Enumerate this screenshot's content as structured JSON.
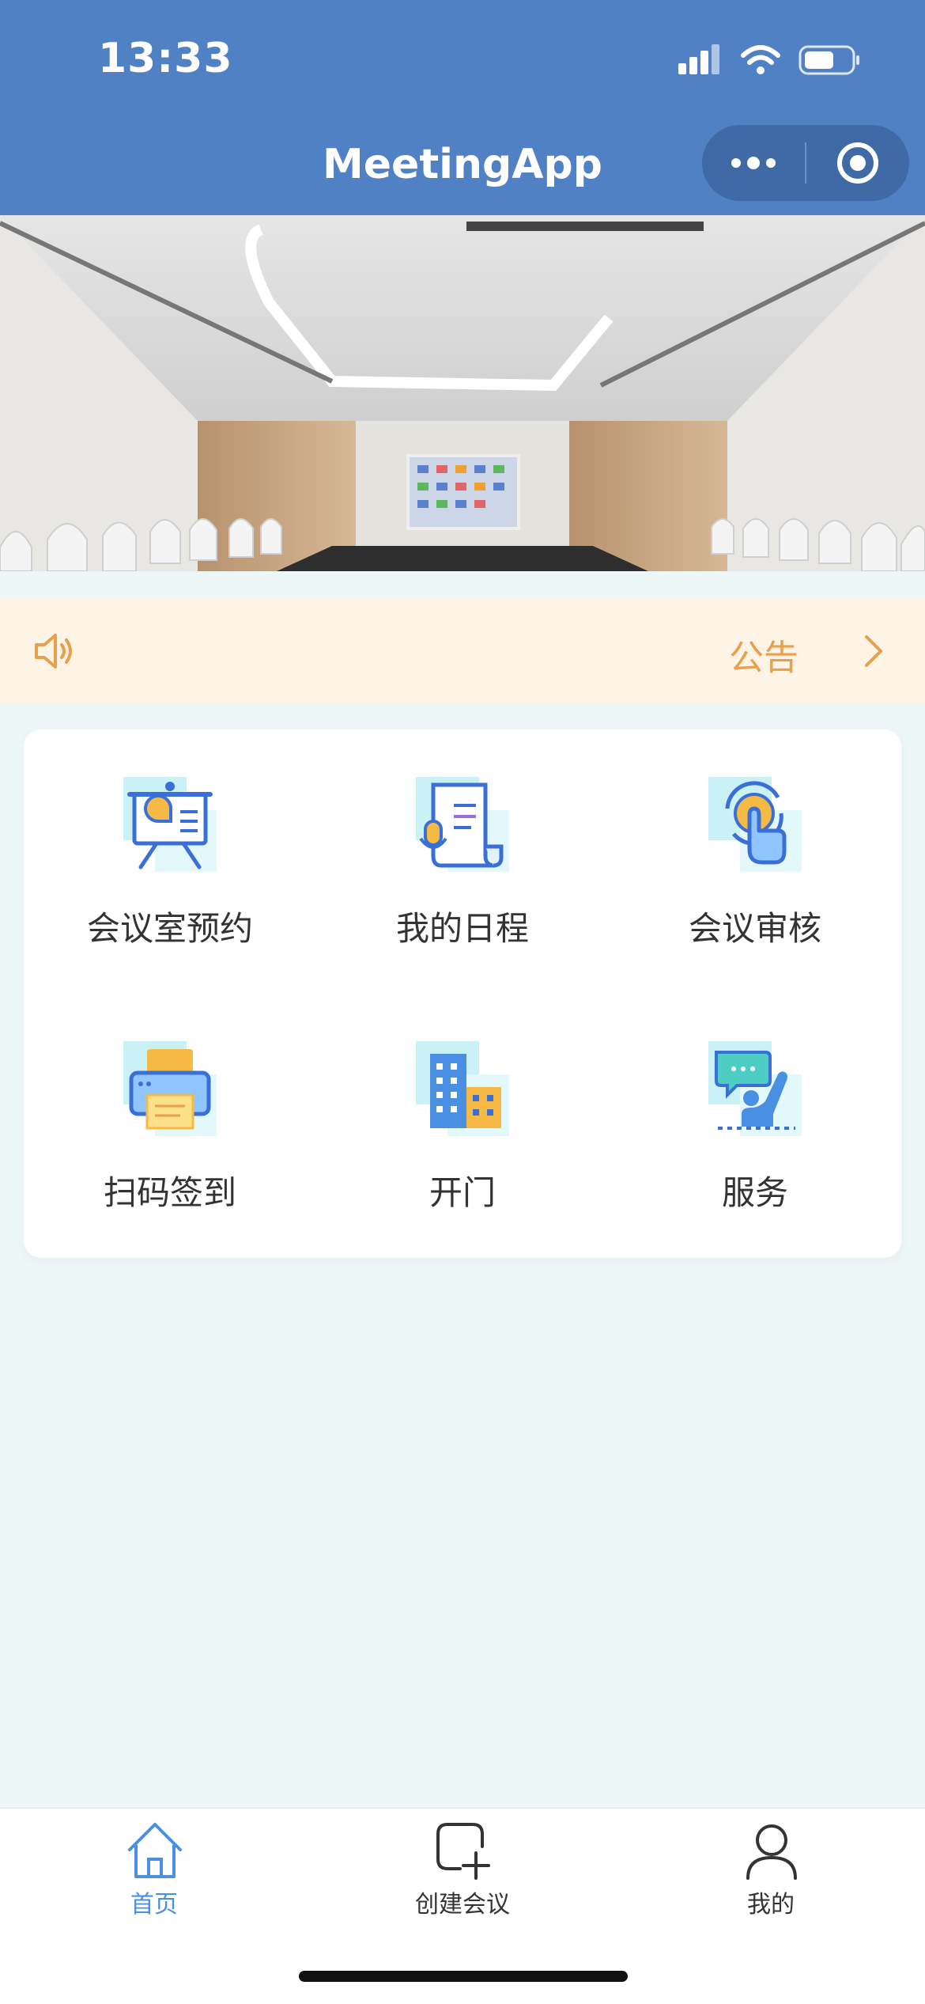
{
  "status_bar": {
    "time": "13:33"
  },
  "nav": {
    "title": "MeetingApp",
    "more_icon": "more-dots-icon",
    "close_icon": "target-circle-icon"
  },
  "notice": {
    "icon": "speaker-icon",
    "label": "公告",
    "arrow_icon": "chevron-right-icon"
  },
  "menu": {
    "items": [
      {
        "label": "会议室预约",
        "icon": "presentation-board-icon"
      },
      {
        "label": "我的日程",
        "icon": "scroll-document-icon"
      },
      {
        "label": "会议审核",
        "icon": "touch-approve-icon"
      },
      {
        "label": "扫码签到",
        "icon": "printer-icon"
      },
      {
        "label": "开门",
        "icon": "building-icon"
      },
      {
        "label": "服务",
        "icon": "support-person-icon"
      }
    ]
  },
  "tabbar": {
    "items": [
      {
        "label": "首页",
        "icon": "home-icon",
        "active": true
      },
      {
        "label": "创建会议",
        "icon": "add-square-icon",
        "active": false
      },
      {
        "label": "我的",
        "icon": "person-icon",
        "active": false
      }
    ]
  },
  "colors": {
    "header": "#5181c5",
    "active_tab": "#4a90e2",
    "notice_text": "#e8a04c",
    "notice_bg": "#fdf4e5"
  }
}
